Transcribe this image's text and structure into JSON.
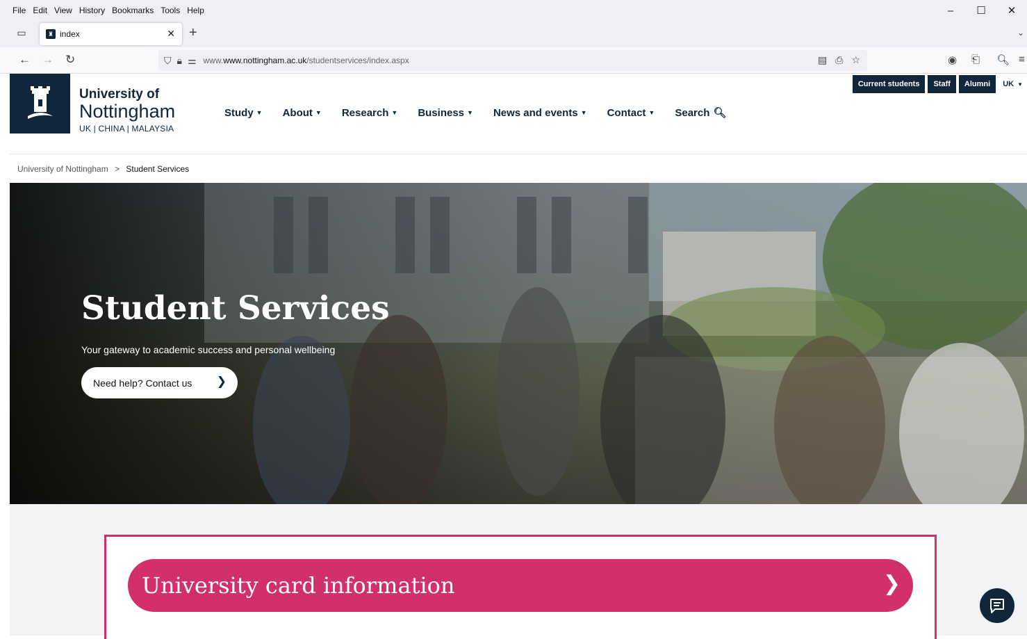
{
  "browser": {
    "menu": [
      "File",
      "Edit",
      "View",
      "History",
      "Bookmarks",
      "Tools",
      "Help"
    ],
    "window_controls": [
      "–",
      "☐",
      "✕"
    ],
    "tab_title": "index",
    "url_domain": "www.nottingham.ac.uk",
    "url_path": "/studentservices/index.aspx",
    "url_prefix": "www."
  },
  "site": {
    "logo": {
      "line1": "University of",
      "line2": "Nottingham",
      "line3": "UK | CHINA | MALAYSIA"
    },
    "nav": [
      {
        "label": "Study"
      },
      {
        "label": "About"
      },
      {
        "label": "Research"
      },
      {
        "label": "Business"
      },
      {
        "label": "News and events"
      },
      {
        "label": "Contact"
      }
    ],
    "search_label": "Search",
    "audience_links": [
      "Current students",
      "Staff",
      "Alumni"
    ],
    "region": "UK",
    "breadcrumb": {
      "home": "University of Nottingham",
      "separator": ">",
      "current": "Student Services"
    }
  },
  "hero": {
    "title": "Student Services",
    "subtitle": "Your gateway to academic success and personal wellbeing",
    "cta": "Need help? Contact us"
  },
  "card": {
    "title": "University card information"
  },
  "colors": {
    "brand_navy": "#10263b",
    "accent_pink": "#d2306a"
  }
}
